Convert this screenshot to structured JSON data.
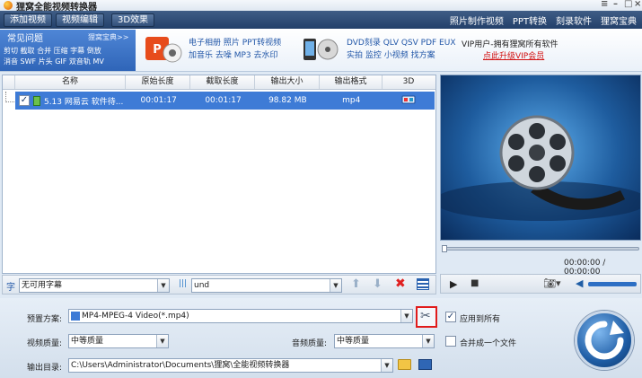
{
  "app": {
    "title": "狸窝全能视频转换器"
  },
  "toolbar": {
    "buttons": [
      "添加视频",
      "视频编辑",
      "3D效果"
    ],
    "links": [
      "照片制作视频",
      "PPT转换",
      "刻录软件",
      "狸窝宝典"
    ]
  },
  "banner": {
    "faq_title": "常见问题",
    "faq_more": "狸窝宝典>>",
    "faq_lines": [
      "剪切 截取 合并 压缩 字幕 倒放",
      "消音 SWF 片头 GIF 双音轨 MV"
    ],
    "photo_lines": [
      "电子相册 照片 PPT转视频",
      "加音乐 去噪 MP3 去水印"
    ],
    "dvd_lines": [
      "DVD刻录 QLV QSV PDF EUX",
      "实拍 监控 小视频 找方案"
    ],
    "vip_text": "VIP用户-拥有狸窝所有软件",
    "vip_link": "点此升级VIP会员"
  },
  "table": {
    "columns": [
      "名称",
      "原始长度",
      "截取长度",
      "输出大小",
      "输出格式",
      "3D"
    ],
    "rows": [
      {
        "name": "5.13 网易云 软件待...",
        "original_length": "00:01:17",
        "cut_length": "00:01:17",
        "output_size": "98.82 MB",
        "format": "mp4",
        "checked": true
      }
    ]
  },
  "player": {
    "time": "00:00:00 / 00:00:00"
  },
  "strip": {
    "subtitle": "无可用字幕",
    "audio": "und"
  },
  "settings": {
    "preset_label": "预置方案:",
    "preset_value": "MP4-MPEG-4 Video(*.mp4)",
    "apply_all": "应用到所有",
    "video_quality_label": "视频质量:",
    "video_quality": "中等质量",
    "audio_quality_label": "音频质量:",
    "audio_quality": "中等质量",
    "merge_label": "合并成一个文件",
    "output_label": "输出目录:",
    "output_path": "C:\\Users\\Administrator\\Documents\\狸窝\\全能视频转换器"
  },
  "colors": {
    "selection": "#3e7bd6",
    "toolbar": "#2c4a74",
    "highlight_box": "#e11b1b"
  }
}
